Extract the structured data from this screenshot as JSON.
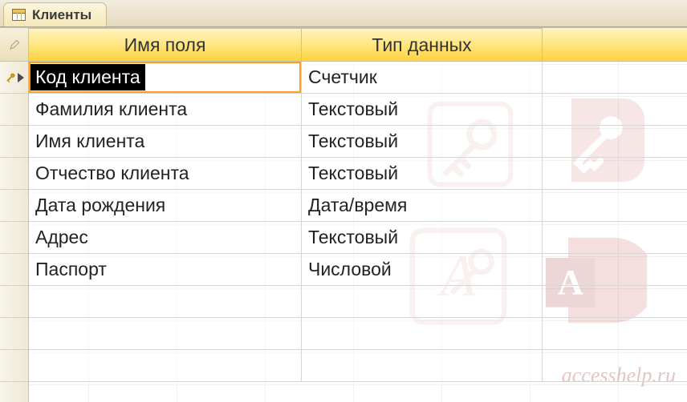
{
  "tab": {
    "title": "Клиенты"
  },
  "columns": {
    "field": "Имя поля",
    "type": "Тип данных"
  },
  "rows": [
    {
      "field": "Код клиента",
      "type": "Счетчик",
      "pk": true,
      "selected": true
    },
    {
      "field": "Фамилия клиента",
      "type": "Текстовый",
      "pk": false,
      "selected": false
    },
    {
      "field": "Имя клиента",
      "type": "Текстовый",
      "pk": false,
      "selected": false
    },
    {
      "field": "Отчество клиента",
      "type": "Текстовый",
      "pk": false,
      "selected": false
    },
    {
      "field": "Дата рождения",
      "type": "Дата/время",
      "pk": false,
      "selected": false
    },
    {
      "field": "Адрес",
      "type": "Текстовый",
      "pk": false,
      "selected": false
    },
    {
      "field": "Паспорт",
      "type": "Числовой",
      "pk": false,
      "selected": false
    }
  ],
  "blank_rows": 3,
  "watermark": {
    "text": "accesshelp.ru"
  },
  "colors": {
    "header_gradient_top": "#fff3bf",
    "header_gradient_bottom": "#ffd23f",
    "selection_border": "#ff9d1f"
  }
}
